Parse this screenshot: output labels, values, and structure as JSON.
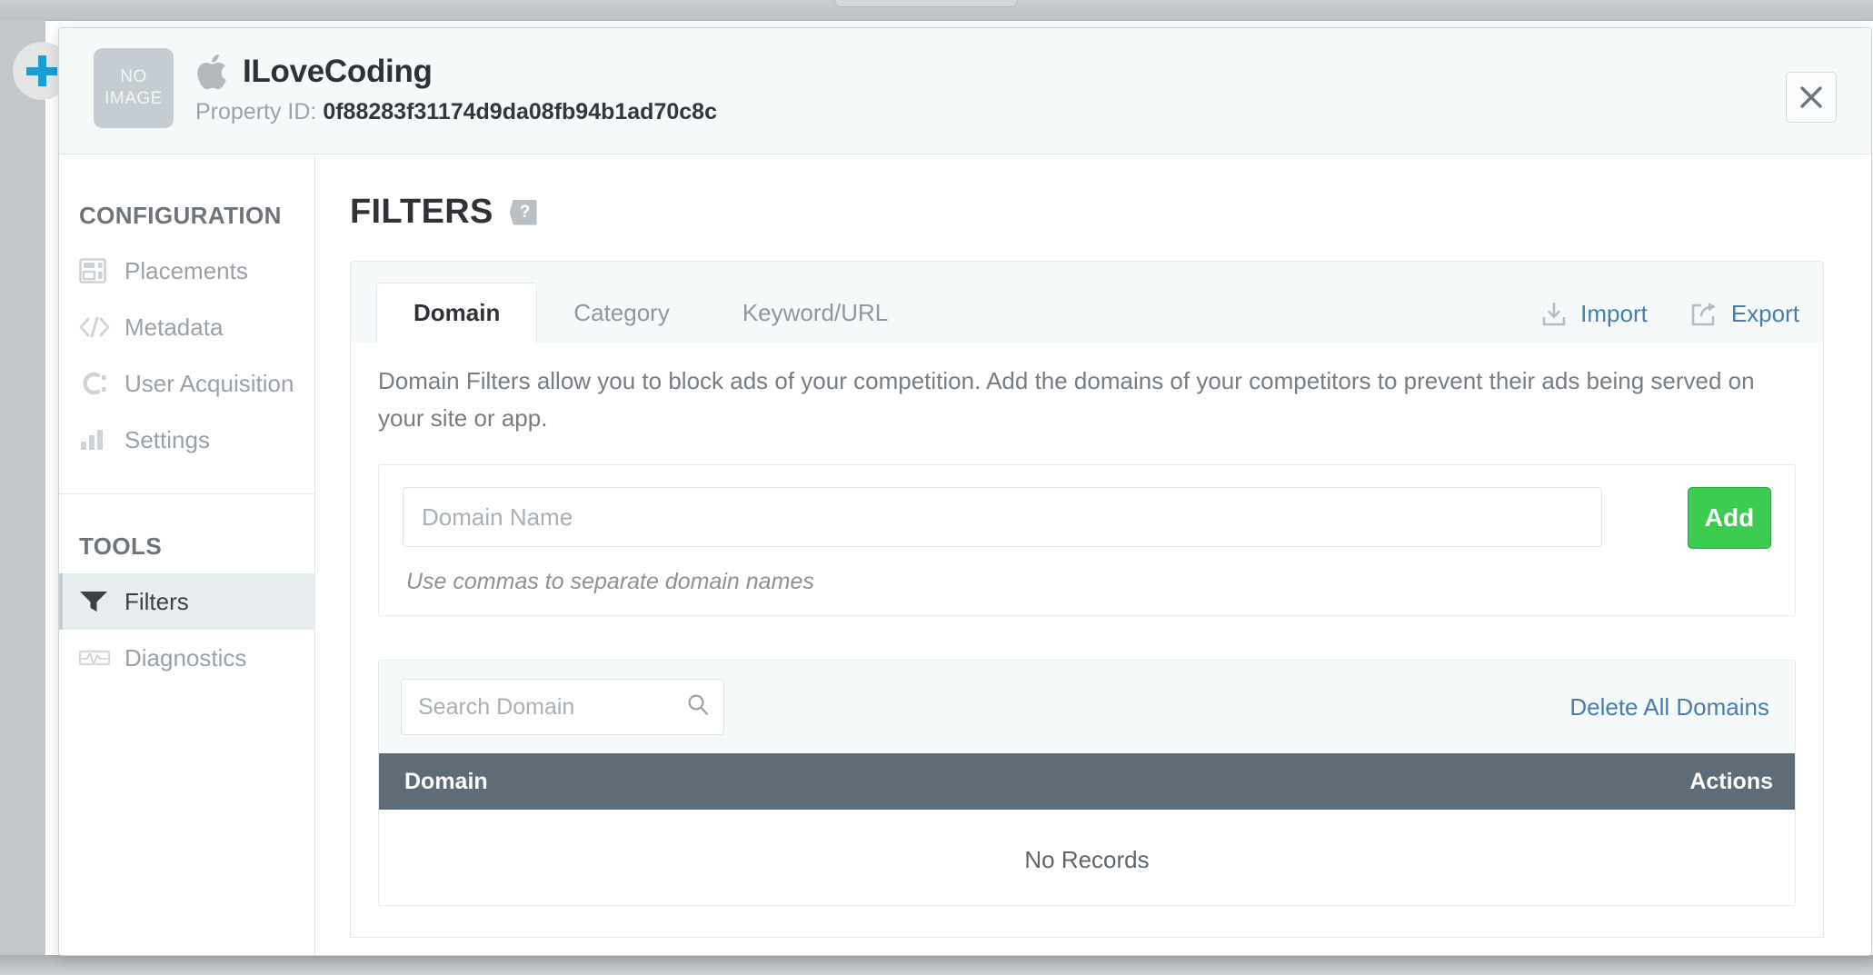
{
  "background": {
    "add_icon_name": "plus-icon"
  },
  "header": {
    "thumb_line1": "NO",
    "thumb_line2": "IMAGE",
    "platform_icon": "apple-icon",
    "property_name": "ILoveCoding",
    "property_id_label": "Property ID:",
    "property_id_value": "0f88283f31174d9da08fb94b1ad70c8c",
    "close_label": "✕"
  },
  "sidebar": {
    "groups": [
      {
        "title": "CONFIGURATION",
        "items": [
          {
            "label": "Placements",
            "icon": "layout-icon",
            "active": false
          },
          {
            "label": "Metadata",
            "icon": "code-icon",
            "active": false
          },
          {
            "label": "User Acquisition",
            "icon": "user-acquisition-icon",
            "active": false
          },
          {
            "label": "Settings",
            "icon": "bar-chart-icon",
            "active": false
          }
        ]
      },
      {
        "title": "TOOLS",
        "items": [
          {
            "label": "Filters",
            "icon": "funnel-icon",
            "active": true
          },
          {
            "label": "Diagnostics",
            "icon": "pulse-icon",
            "active": false
          }
        ]
      }
    ]
  },
  "main": {
    "page_title": "FILTERS",
    "help_badge": "?",
    "tabs": [
      {
        "label": "Domain",
        "active": true
      },
      {
        "label": "Category",
        "active": false
      },
      {
        "label": "Keyword/URL",
        "active": false
      }
    ],
    "actions": [
      {
        "label": "Import",
        "icon": "import-icon"
      },
      {
        "label": "Export",
        "icon": "export-icon"
      }
    ],
    "description": "Domain Filters allow you to block ads of your competition. Add the domains of your competitors to prevent their ads being served on your site or app.",
    "add_form": {
      "input_value": "",
      "input_placeholder": "Domain Name",
      "add_label": "Add",
      "hint": "Use commas to separate domain names"
    },
    "list": {
      "search_value": "",
      "search_placeholder": "Search Domain",
      "search_icon": "search-icon",
      "delete_all_label": "Delete All Domains",
      "columns": [
        "Domain",
        "Actions"
      ],
      "empty_message": "No Records",
      "rows": []
    }
  },
  "colors": {
    "accent_link": "#4a7cb0",
    "add_button": "#3dcc52",
    "table_header": "#5d6c76",
    "sidebar_active": "#e8edf0",
    "header_bg": "#f5f9fa"
  }
}
